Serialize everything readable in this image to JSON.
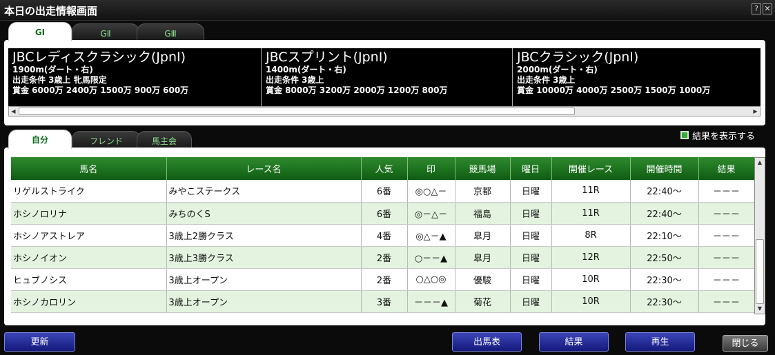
{
  "window": {
    "title": "本日の出走情報画面",
    "help_label": "?",
    "close_label": "✕"
  },
  "grade_tabs": [
    {
      "label": "GⅠ",
      "active": true
    },
    {
      "label": "GⅡ",
      "active": false
    },
    {
      "label": "GⅢ",
      "active": false
    }
  ],
  "grade_races": [
    {
      "name": "JBCレディスクラシック(JpnⅠ)",
      "distance": "1900m(ダート・右)",
      "condition": "出走条件 3歳上 牝馬限定",
      "prize": "賞金  6000万 2400万 1500万 900万 600万"
    },
    {
      "name": "JBCスプリント(JpnⅠ)",
      "distance": "1400m(ダート・右)",
      "condition": "出走条件 3歳上",
      "prize": "賞金  8000万 3200万 2000万 1200万 800万"
    },
    {
      "name": "JBCクラシック(JpnⅠ)",
      "distance": "2000m(ダート・右)",
      "condition": "出走条件 3歳上",
      "prize": "賞金  10000万 4000万 2500万 1500万 1000万"
    }
  ],
  "owner_tabs": [
    {
      "label": "自分",
      "active": true
    },
    {
      "label": "フレンド",
      "active": false
    },
    {
      "label": "馬主会",
      "active": false
    }
  ],
  "show_results": {
    "label": "結果を表示する",
    "checked": true
  },
  "table": {
    "columns": [
      "馬名",
      "レース名",
      "人気",
      "印",
      "競馬場",
      "曜日",
      "開催レース",
      "開催時間",
      "結果"
    ],
    "rows": [
      [
        "リゲルストライク",
        "みやこステークス",
        "6番",
        "◎○△－",
        "京都",
        "日曜",
        "11R",
        "22:40～",
        "－－－"
      ],
      [
        "ホシノロリナ",
        "みちのくS",
        "6番",
        "◎－△－",
        "福島",
        "日曜",
        "11R",
        "22:40～",
        "－－－"
      ],
      [
        "ホシノアストレア",
        "3歳上2勝クラス",
        "4番",
        "◎△－▲",
        "皐月",
        "日曜",
        "8R",
        "22:10～",
        "－－－"
      ],
      [
        "ホシノイオン",
        "3歳上3勝クラス",
        "2番",
        "○－－▲",
        "皐月",
        "日曜",
        "12R",
        "22:50～",
        "－－－"
      ],
      [
        "ヒュブノシス",
        "3歳上オープン",
        "2番",
        "○△○◎",
        "優駿",
        "日曜",
        "10R",
        "22:30～",
        "－－－"
      ],
      [
        "ホシノカロリン",
        "3歳上オープン",
        "3番",
        "－－－▲",
        "菊花",
        "日曜",
        "10R",
        "22:30～",
        "－－－"
      ]
    ]
  },
  "buttons": {
    "refresh": "更新",
    "entries": "出馬表",
    "results": "結果",
    "replay": "再生",
    "close": "閉じる"
  }
}
